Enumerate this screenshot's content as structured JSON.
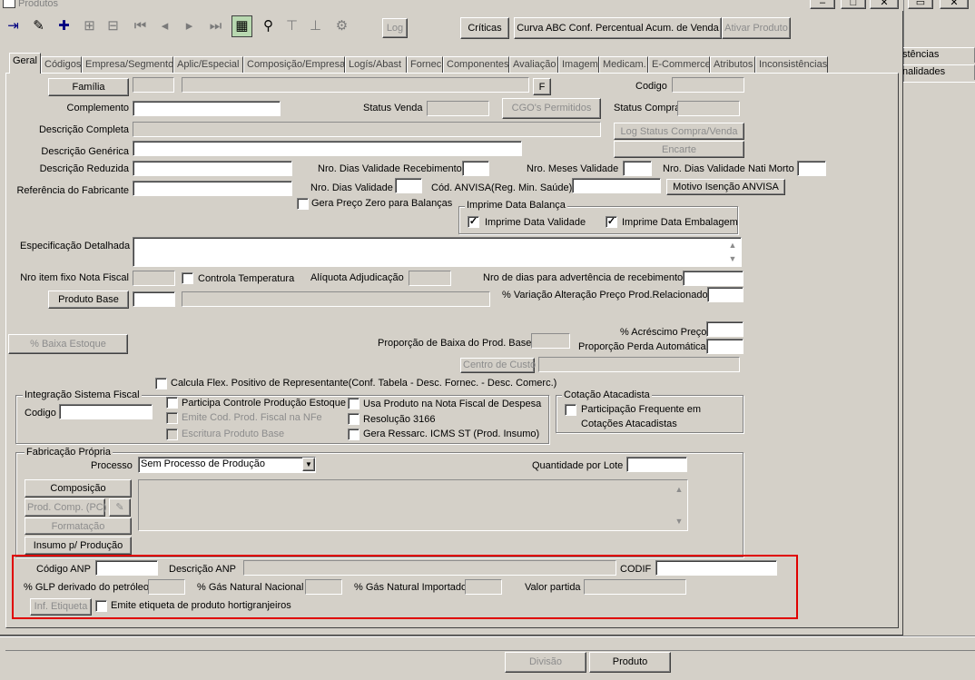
{
  "window": {
    "title": "Produtos"
  },
  "bg_window": {
    "tabs": [
      "stências",
      "nalidades"
    ]
  },
  "toolbar": {
    "log": "Log",
    "criticas": "Críticas",
    "curva_abc": "Curva ABC Conf. Percentual Acum. de Venda",
    "ativar": "Ativar Produto"
  },
  "tabs": [
    "Geral",
    "Códigos",
    "Empresa/Segmento",
    "Aplic/Especial",
    "Composição/Empresa",
    "Logís/Abast",
    "Fornec",
    "Componentes",
    "Avaliação",
    "Imagem",
    "Medicam.",
    "E-Commerce",
    "Atributos",
    "Inconsistências"
  ],
  "form": {
    "familia_btn": "Família",
    "f_btn": "F",
    "codigo": "Codigo",
    "complemento": "Complemento",
    "status_venda": "Status Venda",
    "cgo_btn": "CGO's Permitidos",
    "status_compra": "Status Compra",
    "descricao_completa": "Descrição Completa",
    "log_status_btn": "Log Status Compra/Venda",
    "descricao_generica": "Descrição Genérica",
    "encarte_btn": "Encarte",
    "descricao_reduzida": "Descrição Reduzida",
    "nro_dias_validade_receb": "Nro. Dias Validade Recebimento",
    "nro_meses_validade": "Nro. Meses Validade",
    "nro_dias_nati_morto": "Nro. Dias Validade Nati Morto",
    "ref_fabricante": "Referência do Fabricante",
    "nro_dias_validade": "Nro. Dias Validade",
    "cod_anvisa": "Cód. ANVISA(Reg. Min. Saúde)",
    "motivo_anvisa_btn": "Motivo Isenção ANVISA",
    "gera_preco_zero": "Gera Preço Zero para Balanças",
    "imprime_data_balanca": "Imprime Data Balança",
    "imprime_data_validade": "Imprime Data Validade",
    "imprime_data_embalagem": "Imprime Data Embalagem",
    "especificacao": "Especificação Detalhada",
    "nro_item_fixo": "Nro item fixo Nota Fiscal",
    "controla_temp": "Controla Temperatura",
    "aliquota": "Alíquota Adjudicação",
    "nro_dias_advertencia": "Nro de dias para advertência de recebimento",
    "produto_base_btn": "Produto Base",
    "variacao_preco": "% Variação Alteração Preço Prod.Relacionado",
    "acrescimo_preco": "% Acréscimo Preço",
    "baixa_estoque_btn": "% Baixa Estoque",
    "proporcao_baixa": "Proporção de Baixa do Prod. Base",
    "proporcao_perda": "Proporção Perda Automática",
    "centro_custo_btn": "Centro de Custo",
    "calcula_flex": "Calcula Flex. Positivo de Representante(Conf. Tabela - Desc. Fornec. - Desc. Comerc.)"
  },
  "integracao": {
    "title": "Integração Sistema Fiscal",
    "codigo": "Codigo",
    "participa": "Participa Controle Produção Estoque",
    "emite_cod": "Emite Cod. Prod. Fiscal na NFe",
    "escritura": "Escritura Produto Base",
    "usa_produto": "Usa Produto na Nota Fiscal de Despesa",
    "resolucao": "Resolução 3166",
    "gera_ressarc": "Gera Ressarc. ICMS ST (Prod. Insumo)"
  },
  "cotacao": {
    "title": "Cotação Atacadista",
    "line1": "Participação Frequente em",
    "line2": "Cotações Atacadistas"
  },
  "fabricacao": {
    "title": "Fabricação Própria",
    "processo": "Processo",
    "processo_value": "Sem Processo de Produção",
    "quantidade_lote": "Quantidade por Lote",
    "composicao_btn": "Composição",
    "prod_comp_btn": "Prod. Comp. (PC)",
    "formatacao_btn": "Formatação",
    "insumo_btn": "Insumo p/ Produção"
  },
  "anp": {
    "codigo_anp": "Código ANP",
    "descricao_anp": "Descrição ANP",
    "codif": "CODIF",
    "glp": "% GLP derivado do petróleo",
    "gas_nacional": "% Gás Natural Nacional",
    "gas_importado": "% Gás Natural Importado",
    "valor_partida": "Valor partida",
    "inf_etiqueta_btn": "Inf. Etiqueta",
    "emite_etiqueta": "Emite etiqueta de produto hortigranjeiros"
  },
  "bottom": {
    "divisao": "Divisão",
    "produto": "Produto"
  },
  "colors": {
    "highlight": "#e00000",
    "face": "#d4d0c8"
  }
}
